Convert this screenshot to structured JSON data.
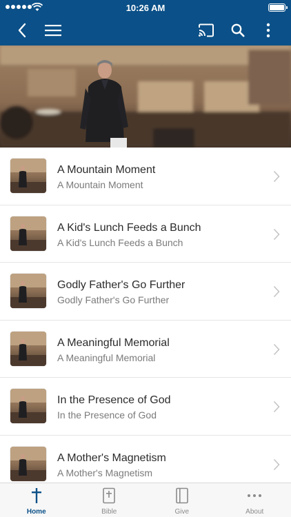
{
  "status_bar": {
    "time": "10:26 AM"
  },
  "colors": {
    "brand": "#0b5088",
    "background": "#ffffff",
    "tab_active": "#0b5088",
    "tab_inactive": "#8a8a8a"
  },
  "nav_bar": {
    "icons": [
      "back-arrow-icon",
      "hamburger-menu-icon",
      "cast-icon",
      "search-icon",
      "more-vertical-icon"
    ]
  },
  "list": [
    {
      "title": "A Mountain Moment",
      "subtitle": "A Mountain Moment"
    },
    {
      "title": "A Kid's Lunch Feeds a Bunch",
      "subtitle": "A Kid's Lunch Feeds a Bunch"
    },
    {
      "title": "Godly Father's Go Further",
      "subtitle": "Godly Father's Go Further"
    },
    {
      "title": "A Meaningful Memorial",
      "subtitle": "A Meaningful Memorial"
    },
    {
      "title": "In the Presence of God",
      "subtitle": "In the Presence of God"
    },
    {
      "title": "A Mother's Magnetism",
      "subtitle": "A Mother's Magnetism"
    }
  ],
  "tab_bar": {
    "tabs": [
      {
        "label": "Home",
        "icon": "cross-icon",
        "active": true
      },
      {
        "label": "Bible",
        "icon": "bible-icon",
        "active": false
      },
      {
        "label": "Give",
        "icon": "book-icon",
        "active": false
      },
      {
        "label": "About",
        "icon": "ellipsis-icon",
        "active": false
      }
    ]
  }
}
